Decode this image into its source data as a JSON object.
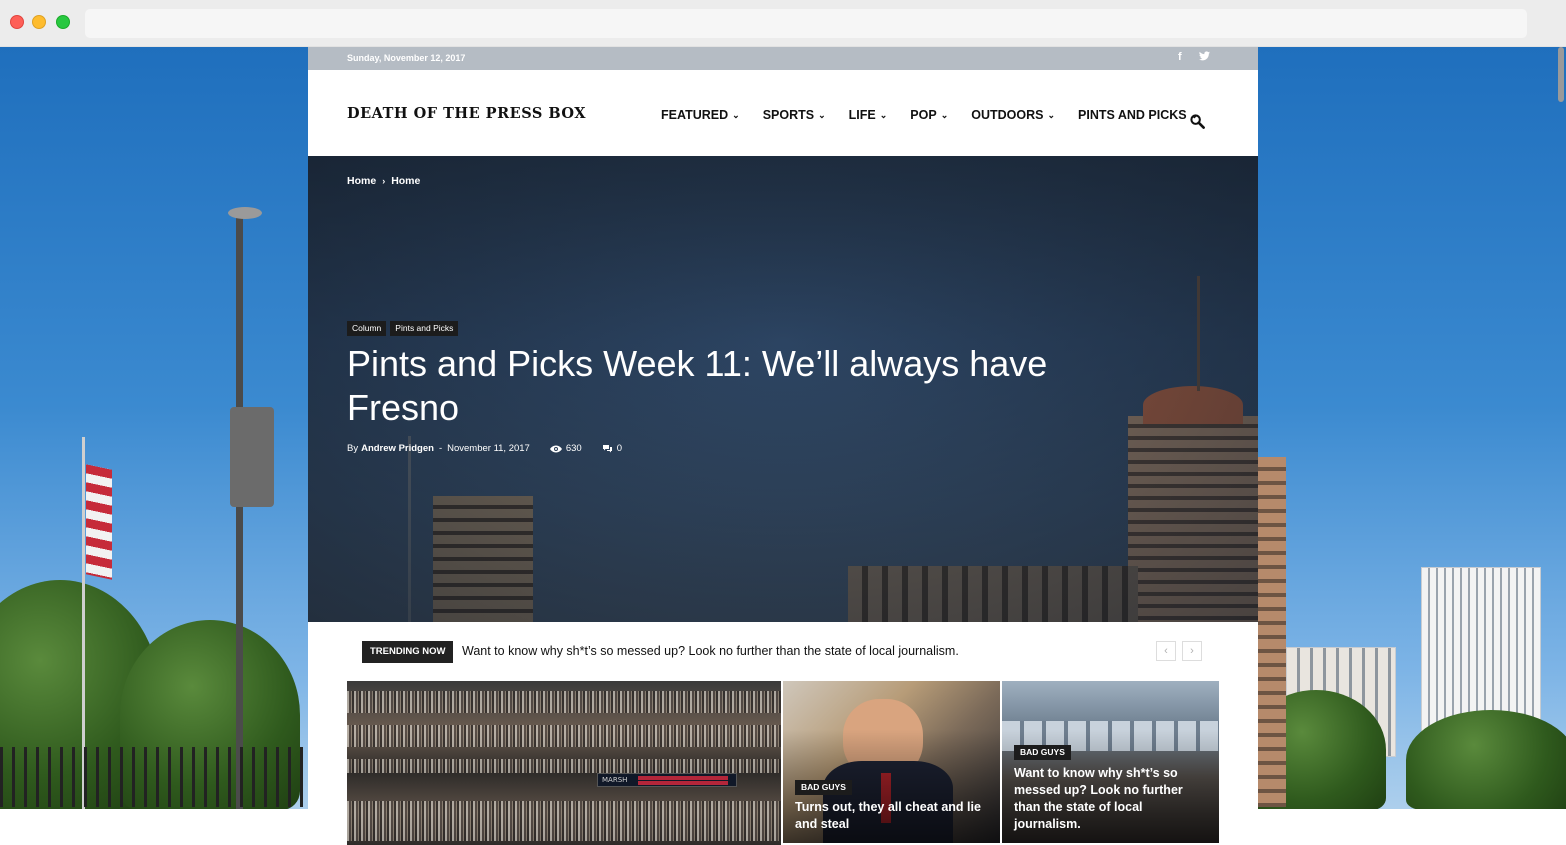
{
  "site": {
    "date": "Sunday, November 12, 2017",
    "logo": "DEATH OF THE PRESS BOX",
    "nav": [
      {
        "label": "FEATURED"
      },
      {
        "label": "SPORTS"
      },
      {
        "label": "LIFE"
      },
      {
        "label": "POP"
      },
      {
        "label": "OUTDOORS"
      },
      {
        "label": "PINTS AND PICKS"
      }
    ],
    "social": {
      "facebook": "f",
      "twitter": "🐦"
    }
  },
  "breadcrumb": [
    "Home",
    "Home"
  ],
  "breadcrumb_separator": "›",
  "hero": {
    "tags": [
      "Column",
      "Pints and Picks"
    ],
    "title": "Pints and Picks Week 11: We’ll always have Fresno",
    "by": "By",
    "author": "Andrew Pridgen",
    "dash": "-",
    "date": "November 11, 2017",
    "views": "630",
    "comments": "0"
  },
  "trending": {
    "label": "TRENDING NOW",
    "text": "Want to know why sh*t’s so messed up? Look no further than the state of local journalism.",
    "prev": "‹",
    "next": "›"
  },
  "cards": [
    {
      "category": "",
      "title": "",
      "scoreboard": "MARSH"
    },
    {
      "category": "BAD GUYS",
      "title": "Turns out, they all cheat and lie and steal"
    },
    {
      "category": "BAD GUYS",
      "title": "Want to know why sh*t’s so messed up? Look no further than the state of local journalism."
    }
  ],
  "colors": {
    "topbar": "#b5bcc4",
    "tag_bg": "#1c1c1c",
    "hero_bg": "#2c4462",
    "sky": "#3b8ad0"
  },
  "icons": {
    "search": "search-icon",
    "views": "eye-icon",
    "comments": "comment-icon",
    "dropdown": "chevron-down-icon"
  }
}
